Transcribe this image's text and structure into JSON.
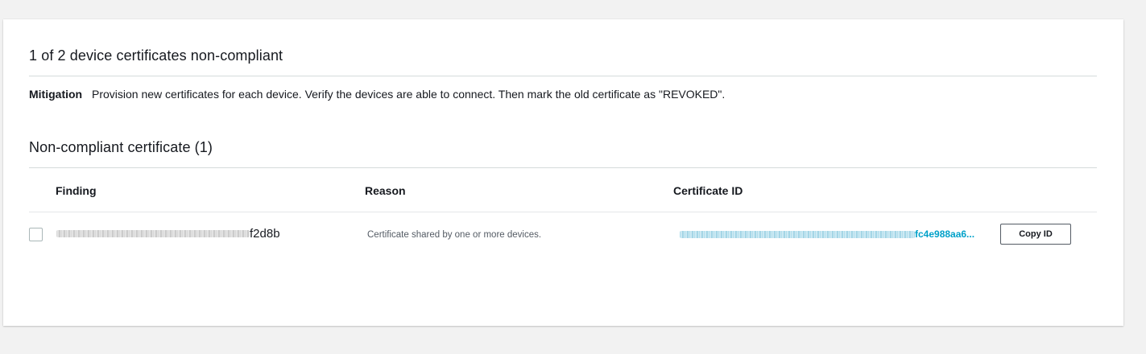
{
  "summary": {
    "title": "1 of 2 device certificates non-compliant",
    "mitigation_label": "Mitigation",
    "mitigation_text": "Provision new certificates for each device. Verify the devices are able to connect. Then mark the old certificate as \"REVOKED\"."
  },
  "certificates_section": {
    "title": "Non-compliant certificate (1)",
    "columns": {
      "finding": "Finding",
      "reason": "Reason",
      "certificate_id": "Certificate ID"
    },
    "rows": [
      {
        "finding_visible_suffix": "f2d8b",
        "reason": "Certificate shared by one or more devices.",
        "certificate_id_visible": "fc4e988aa6...",
        "copy_label": "Copy ID"
      }
    ]
  },
  "colors": {
    "link": "#00a1c9",
    "divider": "#d5dbdb",
    "background": "#f2f2f2"
  }
}
